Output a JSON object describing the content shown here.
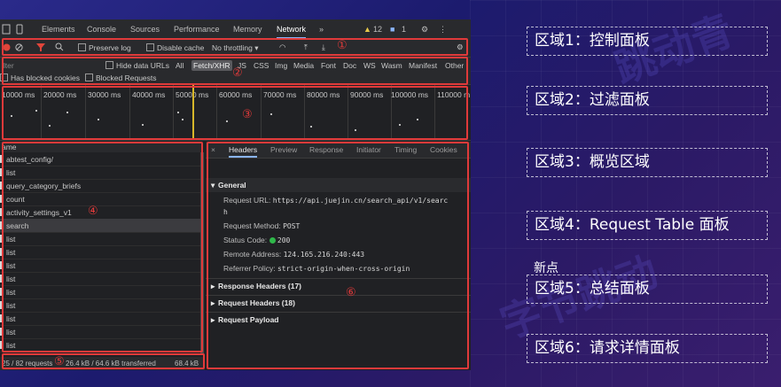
{
  "devtools": {
    "tabs": [
      "Elements",
      "Console",
      "Sources",
      "Performance",
      "Memory",
      "Network"
    ],
    "active_tab": "Network",
    "more_tabs": "»",
    "warnings_count": "12",
    "messages_count": "1",
    "toolbar": {
      "preserve_log": "Preserve log",
      "disable_cache": "Disable cache",
      "throttling": "No throttling"
    },
    "filter": {
      "placeholder": "ilter",
      "hide_data_urls": "Hide data URLs",
      "types": [
        "All",
        "Fetch/XHR",
        "JS",
        "CSS",
        "Img",
        "Media",
        "Font",
        "Doc",
        "WS",
        "Wasm",
        "Manifest",
        "Other"
      ],
      "active_type": "Fetch/XHR",
      "has_blocked_cookies": "Has blocked cookies",
      "blocked_requests": "Blocked Requests"
    },
    "overview_ticks": [
      "10000 ms",
      "20000 ms",
      "30000 ms",
      "40000 ms",
      "50000 ms",
      "60000 ms",
      "70000 ms",
      "80000 ms",
      "90000 ms",
      "100000 ms",
      "110000 m"
    ],
    "request_table": {
      "header": "ame",
      "rows": [
        "abtest_config/",
        "list",
        "query_category_briefs",
        "count",
        "activity_settings_v1",
        "search",
        "list",
        "list",
        "list",
        "list",
        "list",
        "list",
        "list",
        "list",
        "list"
      ],
      "selected_index": 5
    },
    "summary": {
      "requests": "25 / 82 requests",
      "transferred": "26.4 kB / 64.6 kB transferred",
      "resources": "68.4 kB"
    },
    "details": {
      "tabs": [
        "Headers",
        "Preview",
        "Response",
        "Initiator",
        "Timing",
        "Cookies"
      ],
      "active_tab": "Headers",
      "general_title": "General",
      "request_url_label": "Request URL:",
      "request_url_value": "https://api.juejin.cn/search_api/v1/searc",
      "request_url_wrap": "h",
      "request_method_label": "Request Method:",
      "request_method_value": "POST",
      "status_code_label": "Status Code:",
      "status_code_value": "200",
      "remote_address_label": "Remote Address:",
      "remote_address_value": "124.165.216.240:443",
      "referrer_policy_label": "Referrer Policy:",
      "referrer_policy_value": "strict-origin-when-cross-origin",
      "sections": [
        "Response Headers (17)",
        "Request Headers (18)",
        "Request Payload"
      ]
    }
  },
  "region_markers": [
    "①",
    "②",
    "③",
    "④",
    "⑤",
    "⑥"
  ],
  "legend": [
    "区域1：控制面板",
    "区域2：过滤面板",
    "区域3：概览区域",
    "区域4：Request Table 面板",
    "区域5：总结面板",
    "区域6：请求详情面板"
  ],
  "footnote": "新点",
  "colors": {
    "highlight_red": "#e03a3a",
    "status_green": "#2fb84a",
    "accent_blue": "#8ab4f8"
  }
}
